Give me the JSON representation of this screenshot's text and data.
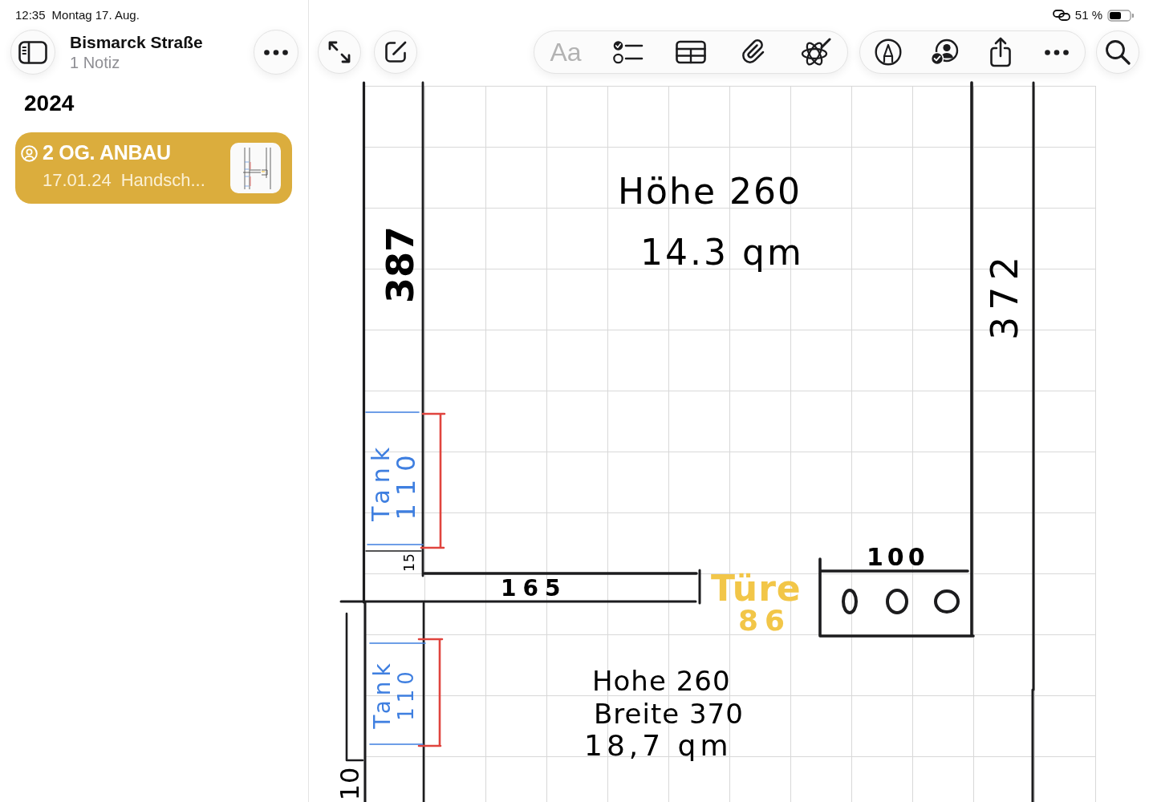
{
  "status_bar": {
    "time": "12:35",
    "date": "Montag 17. Aug.",
    "battery": "51 %"
  },
  "sidebar": {
    "folder_title": "Bismarck Straße",
    "note_count": "1 Notiz",
    "section_title": "2024",
    "notes": [
      {
        "title": "2 OG. ANBAU",
        "date": "17.01.24",
        "preview": "Handsch...",
        "shared": true,
        "selected": true
      }
    ]
  },
  "toolbar": {
    "format_label": "Aa",
    "format_disabled": true
  },
  "canvas": {
    "labels": [
      {
        "text": "Höhe 260",
        "color": "#000000"
      },
      {
        "text": "14.3 qm",
        "color": "#000000"
      },
      {
        "text": "387",
        "color": "#000000"
      },
      {
        "text": "372",
        "color": "#000000"
      },
      {
        "text": "Tank",
        "color": "#3f7fe0"
      },
      {
        "text": "110",
        "color": "#3f7fe0"
      },
      {
        "text": "100",
        "color": "#000000"
      },
      {
        "text": "15",
        "color": "#000000"
      },
      {
        "text": "165",
        "color": "#000000"
      },
      {
        "text": "Türe",
        "color": "#f2c648"
      },
      {
        "text": "86",
        "color": "#f2c648"
      },
      {
        "text": "Tank",
        "color": "#3f7fe0"
      },
      {
        "text": "110",
        "color": "#3f7fe0"
      },
      {
        "text": "Hohe 260",
        "color": "#000000"
      },
      {
        "text": "Breite 370",
        "color": "#000000"
      },
      {
        "text": "18,7 qm",
        "color": "#000000"
      },
      {
        "text": "10",
        "color": "#000000"
      }
    ]
  }
}
